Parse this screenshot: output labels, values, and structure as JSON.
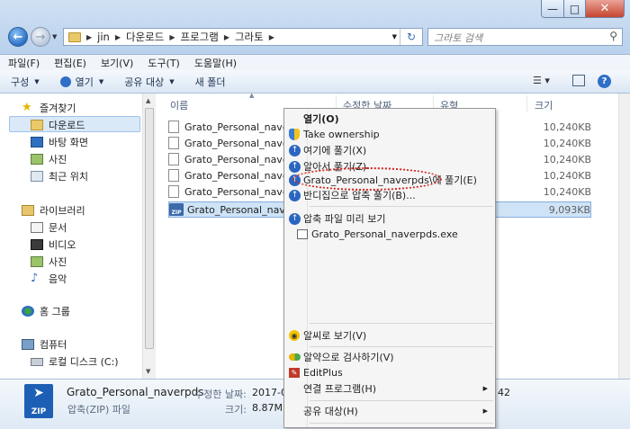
{
  "window": {
    "minimize_icon": "minimize-icon",
    "maximize_icon": "maximize-icon",
    "close_icon": "close-icon"
  },
  "address": {
    "segments": [
      "jin",
      "다운로드",
      "프로그램",
      "그라토"
    ],
    "search_placeholder": "그라토 검색"
  },
  "menubar": [
    "파일(F)",
    "편집(E)",
    "보기(V)",
    "도구(T)",
    "도움말(H)"
  ],
  "toolbar": {
    "organize": "구성",
    "open": "열기",
    "share": "공유 대상",
    "new_folder": "새 폴더"
  },
  "nav": {
    "favorites": "즐겨찾기",
    "downloads": "다운로드",
    "desktop": "바탕 화면",
    "pictures_fav": "사진",
    "recent": "최근 위치",
    "libraries": "라이브러리",
    "documents": "문서",
    "videos": "비디오",
    "pictures": "사진",
    "music": "음악",
    "homegroup": "홈 그룹",
    "computer": "컴퓨터",
    "local_disk": "로컬 디스크 (C:)"
  },
  "columns": {
    "name": "이름",
    "modified": "수정한 날짜",
    "type": "유형",
    "size": "크기"
  },
  "files": [
    {
      "name": "Grato_Personal_naverpd",
      "size": "10,240KB",
      "zip": false
    },
    {
      "name": "Grato_Personal_naverpd",
      "size": "10,240KB",
      "zip": false
    },
    {
      "name": "Grato_Personal_naverpd",
      "size": "10,240KB",
      "zip": false
    },
    {
      "name": "Grato_Personal_naverpd",
      "size": "10,240KB",
      "zip": false
    },
    {
      "name": "Grato_Personal_naverpd",
      "size": "10,240KB",
      "zip": false
    },
    {
      "name": "Grato_Personal_naverpd",
      "size": "9,093KB",
      "zip": true
    }
  ],
  "details": {
    "filename": "Grato_Personal_naverpds",
    "filetype": "압축(ZIP) 파일",
    "modified_label": "수정한 날짜:",
    "modified_value": "2017-0",
    "size_label": "크기:",
    "size_value": "8.87M",
    "partial": "42"
  },
  "context_menu": {
    "open": "열기(O)",
    "take_ownership": "Take ownership",
    "extract_here": "여기에 풀기(X)",
    "extract_auto": "알아서 풀기(Z)",
    "extract_to_folder": "Grato_Personal_naverpds\\에 풀기(E)",
    "extract_different": "반디집으로 압축 풀기(B)...",
    "preview": "압축 파일 미리 보기",
    "preview_file": "Grato_Personal_naverpds.exe",
    "alzip_view": "알씨로 보기(V)",
    "scan": "알약으로 검사하기(V)",
    "editplus": "EditPlus",
    "open_with": "연결 프로그램(H)",
    "share_with": "공유 대상(H)"
  }
}
